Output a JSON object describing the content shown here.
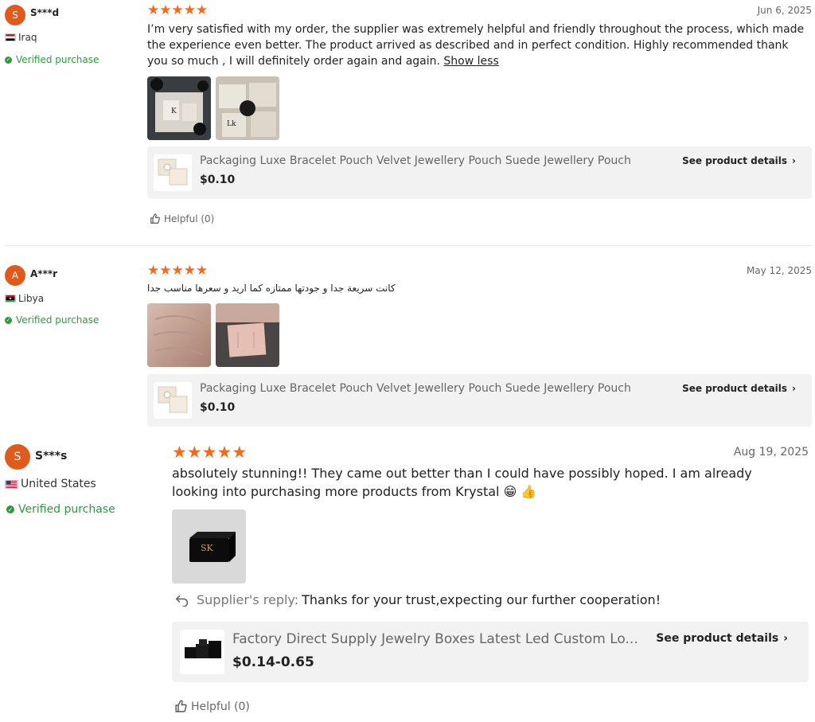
{
  "colors": {
    "accent": "#f26b1d",
    "avatar": "#e05a1b",
    "verified": "#2e9a3e",
    "card_bg": "#f2f2f2"
  },
  "reviews": [
    {
      "avatar_letter": "S",
      "user": "S***d",
      "country": "Iraq",
      "verified": "Verified purchase",
      "rating": 5,
      "date": "Jun 6, 2025",
      "text": "I’m very satisfied with my order, the supplier was extremely helpful and friendly throughout the process, which made the experience even better. The product arrived as described and in perfect condition. Highly recommended thank you so much , I will definitely order again and again.",
      "show_less": "Show less",
      "product": {
        "title": "Packaging Luxe Bracelet Pouch Velvet Jewellery Pouch Suede Jewellery Pouch",
        "price": "$0.10",
        "see_details": "See product details"
      },
      "helpful": "Helpful (0)"
    },
    {
      "avatar_letter": "A",
      "user": "A***r",
      "country": "Libya",
      "verified": "Verified purchase",
      "rating": 5,
      "date": "May 12, 2025",
      "text": "كانت سريعة جدا و جودتها ممتازه كما اريد و سعرها مناسب جدا",
      "product": {
        "title": "Packaging Luxe Bracelet Pouch Velvet Jewellery Pouch Suede Jewellery Pouch",
        "price": "$0.10",
        "see_details": "See product details"
      }
    },
    {
      "avatar_letter": "S",
      "user": "S***s",
      "country": "United States",
      "verified": "Verified purchase",
      "rating": 5,
      "date": "Aug 19, 2025",
      "text": "absolutely stunning!! They came out better than I could have possibly hoped. I am already looking into purchasing more products from Krystal 😁 👍",
      "reply_label": "Supplier's reply:",
      "reply_text": "Thanks for your trust,expecting our further cooperation!",
      "product": {
        "title": "Factory Direct Supply Jewelry Boxes Latest Led Custom Lo...",
        "price": "$0.14-0.65",
        "see_details": "See product details"
      },
      "helpful": "Helpful (0)"
    }
  ]
}
